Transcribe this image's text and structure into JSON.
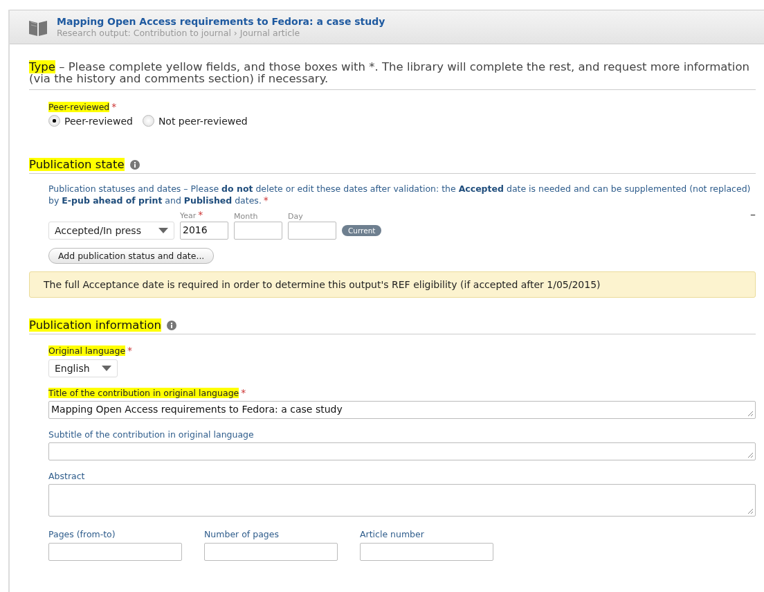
{
  "header": {
    "title": "Mapping Open Access requirements to Fedora: a case study",
    "breadcrumb": "Research output: Contribution to journal › Journal article"
  },
  "type_section": {
    "heading": "Type",
    "intro": " – Please complete yellow fields, and those boxes with *. The library will complete the rest, and request more information (via the history and comments section) if necessary.",
    "field": {
      "label": "Peer-reviewed",
      "mark": "*",
      "highlighted": true
    },
    "options": [
      {
        "label": "Peer-reviewed",
        "selected": true
      },
      {
        "label": "Not peer-reviewed",
        "selected": false
      }
    ]
  },
  "publication_state": {
    "heading": "Publication state",
    "description": "Publication statuses and dates – Please **do not** delete or edit these dates after validation: the **Accepted** date is needed and can be supplemented (not replaced) by **E-pub ahead of print** and **Published** dates.",
    "mark": "*",
    "status": "Accepted/In press",
    "year": {
      "label": "Year",
      "mark": "*",
      "value": "2016"
    },
    "month": {
      "label": "Month"
    },
    "day": {
      "label": "Day"
    },
    "badge": "Current",
    "remove": "–",
    "add_button": "Add publication status and date...",
    "notice": "The full Acceptance date is required in order to determine this output's REF eligibility (if accepted after 1/05/2015)"
  },
  "publication_information": {
    "heading": "Publication information",
    "language": {
      "label": "Original language",
      "mark": "*",
      "highlighted": true,
      "value": "English"
    },
    "fields": [
      {
        "kind": "line",
        "label": "Title of the contribution in original language",
        "mark": "*",
        "highlighted": true,
        "value": "Mapping Open Access requirements to Fedora: a case study"
      },
      {
        "kind": "line",
        "label": "Subtitle of the contribution in original language",
        "highlighted": false
      },
      {
        "kind": "area",
        "label": "Abstract",
        "highlighted": false
      }
    ],
    "small_fields": [
      {
        "label": "Pages (from-to)"
      },
      {
        "label": "Number of pages"
      },
      {
        "label": "Article number"
      }
    ]
  }
}
